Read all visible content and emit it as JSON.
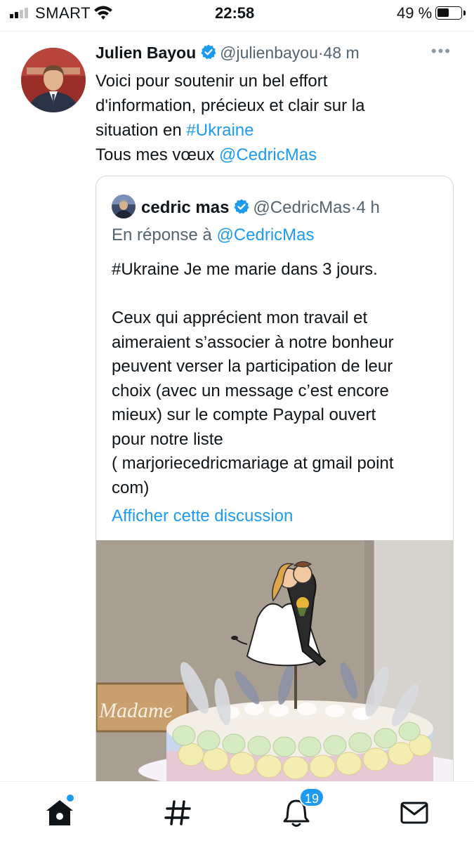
{
  "status_bar": {
    "carrier": "SMART",
    "time": "22:58",
    "battery_percent": "49 %",
    "battery_level": 0.49,
    "signal_bars_filled": 2
  },
  "tweet": {
    "author_name": "Julien Bayou",
    "author_handle": "@julienbayou",
    "dot": "·",
    "age": "48 m",
    "more": "•••",
    "text_line1": "Voici pour soutenir un bel effort",
    "text_line2": "d'information, précieux et clair sur la",
    "text_line3_prefix": "situation en ",
    "hashtag": "#Ukraine",
    "text_line4_prefix": "Tous mes vœux ",
    "mention": "@CedricMas"
  },
  "quoted_tweet": {
    "author_name": "cedric mas",
    "author_handle": "@CedricMas",
    "dot": "·",
    "age": "4 h",
    "reply_prefix": "En réponse à ",
    "reply_to": "@CedricMas",
    "text_lines": [
      "#Ukraine Je me marie dans 3 jours.",
      "",
      "Ceux qui apprécient mon travail et",
      "aimeraient s’associer à notre bonheur",
      "peuvent verser la participation de leur",
      "choix (avec un message c’est encore",
      "mieux) sur le compte Paypal ouvert",
      "pour notre liste",
      "( marjoriecedricmariage at gmail point",
      "com)"
    ],
    "show_thread": "Afficher cette discussion",
    "image_sign_text": "Madame"
  },
  "bottom_nav": {
    "items": [
      {
        "icon": "home-icon"
      },
      {
        "icon": "hashtag-icon"
      },
      {
        "icon": "bell-icon",
        "badge": "19"
      },
      {
        "icon": "envelope-icon"
      }
    ],
    "notification_badge": "19"
  },
  "colors": {
    "link": "#1d9bf0",
    "text": "#0f1419",
    "secondary": "#536471",
    "border": "#cfd9de"
  }
}
